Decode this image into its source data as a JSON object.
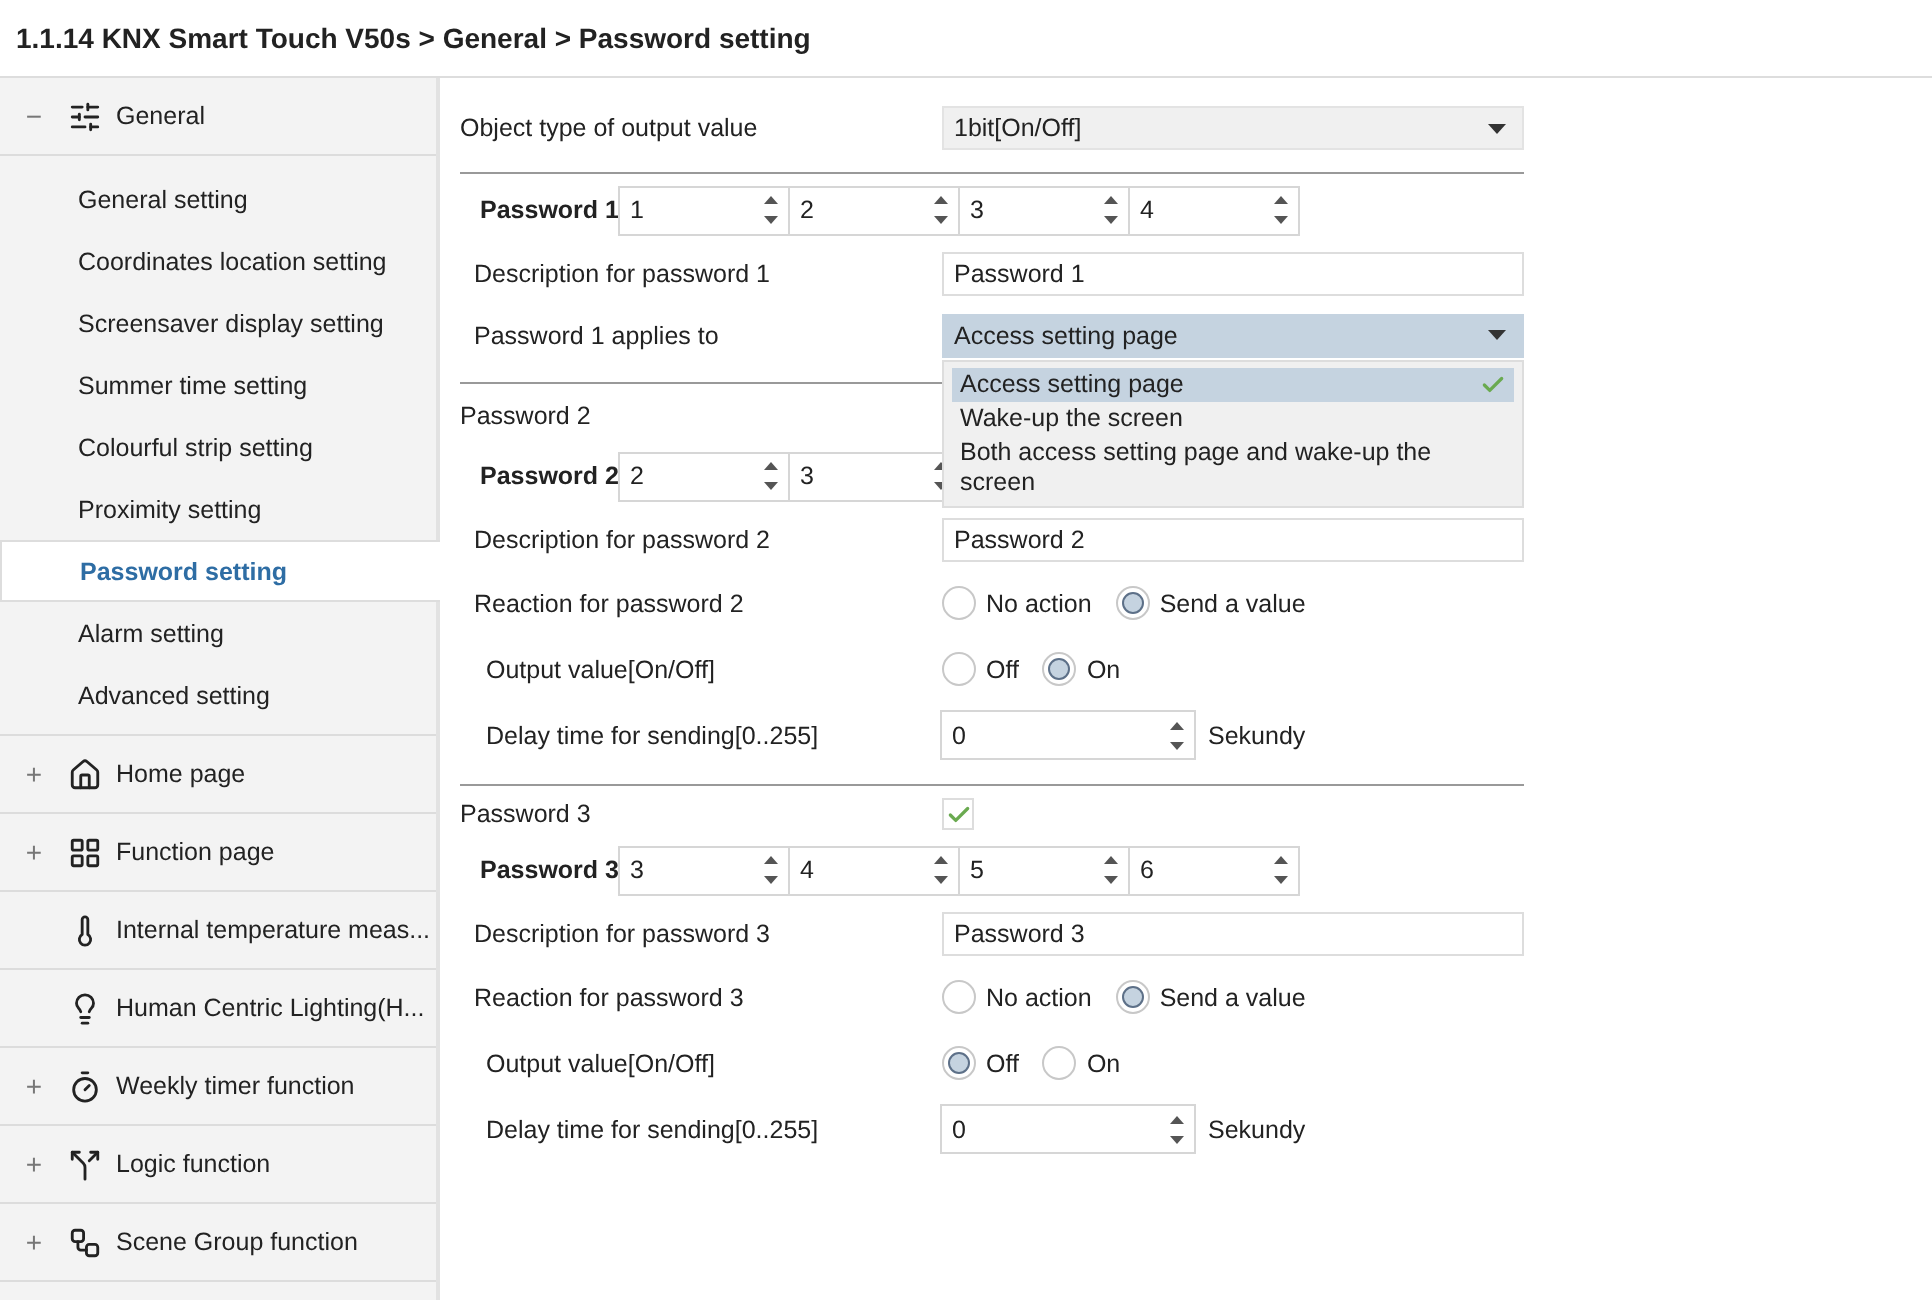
{
  "breadcrumb": "1.1.14 KNX Smart Touch V50s > General > Password setting",
  "sidebar": {
    "groups": [
      {
        "label": "General",
        "expander": "−",
        "children": [
          {
            "label": "General setting",
            "selected": false
          },
          {
            "label": "Coordinates location setting",
            "selected": false
          },
          {
            "label": "Screensaver display setting",
            "selected": false
          },
          {
            "label": "Summer time setting",
            "selected": false
          },
          {
            "label": "Colourful strip setting",
            "selected": false
          },
          {
            "label": "Proximity setting",
            "selected": false
          },
          {
            "label": "Password setting",
            "selected": true
          },
          {
            "label": "Alarm setting",
            "selected": false
          },
          {
            "label": "Advanced setting",
            "selected": false
          }
        ]
      },
      {
        "label": "Home page",
        "expander": "+"
      },
      {
        "label": "Function page",
        "expander": "+"
      },
      {
        "label": "Internal temperature meas..."
      },
      {
        "label": "Human Centric Lighting(H..."
      },
      {
        "label": "Weekly timer function",
        "expander": "+"
      },
      {
        "label": "Logic function",
        "expander": "+"
      },
      {
        "label": "Scene Group function",
        "expander": "+"
      }
    ]
  },
  "object_type": {
    "label": "Object type of output value",
    "value": "1bit[On/Off]"
  },
  "sections": [
    {
      "password": {
        "label": "Password 1",
        "digits": [
          "1",
          "2",
          "3",
          "4"
        ]
      },
      "rows": [
        {
          "kind": "text",
          "label": "Description for password 1",
          "value": "Password 1"
        },
        {
          "kind": "select",
          "label": "Password 1 applies to",
          "value": "Access setting page",
          "open": true,
          "options": [
            {
              "label": "Access setting page",
              "selected": true
            },
            {
              "label": "Wake-up the screen",
              "selected": false
            },
            {
              "label": "Both access setting page and wake-up the screen",
              "selected": false
            }
          ]
        }
      ]
    },
    {
      "title": "Password 2",
      "password": {
        "label": "Password 2",
        "digits": [
          "2",
          "3"
        ]
      },
      "rows": [
        {
          "kind": "text",
          "label": "Description for password 2",
          "value": "Password 2"
        },
        {
          "kind": "radio",
          "label": "Reaction for password 2",
          "options": [
            {
              "label": "No action",
              "selected": false
            },
            {
              "label": "Send a value",
              "selected": true
            }
          ]
        },
        {
          "kind": "radio",
          "label": "Output value[On/Off]",
          "nested": true,
          "options": [
            {
              "label": "Off",
              "selected": false
            },
            {
              "label": "On",
              "selected": true
            }
          ]
        },
        {
          "kind": "spin",
          "label": "Delay time for sending[0..255]",
          "nested": true,
          "value": "0",
          "unit": "Sekundy"
        }
      ]
    },
    {
      "title": "Password 3",
      "enabled": true,
      "password": {
        "label": "Password 3",
        "digits": [
          "3",
          "4",
          "5",
          "6"
        ]
      },
      "rows": [
        {
          "kind": "text",
          "label": "Description for password 3",
          "value": "Password 3"
        },
        {
          "kind": "radio",
          "label": "Reaction for password 3",
          "options": [
            {
              "label": "No action",
              "selected": false
            },
            {
              "label": "Send a value",
              "selected": true
            }
          ]
        },
        {
          "kind": "radio",
          "label": "Output value[On/Off]",
          "nested": true,
          "options": [
            {
              "label": "Off",
              "selected": true
            },
            {
              "label": "On",
              "selected": false
            }
          ]
        },
        {
          "kind": "spin",
          "label": "Delay time for sending[0..255]",
          "nested": true,
          "value": "0",
          "unit": "Sekundy"
        }
      ]
    }
  ]
}
